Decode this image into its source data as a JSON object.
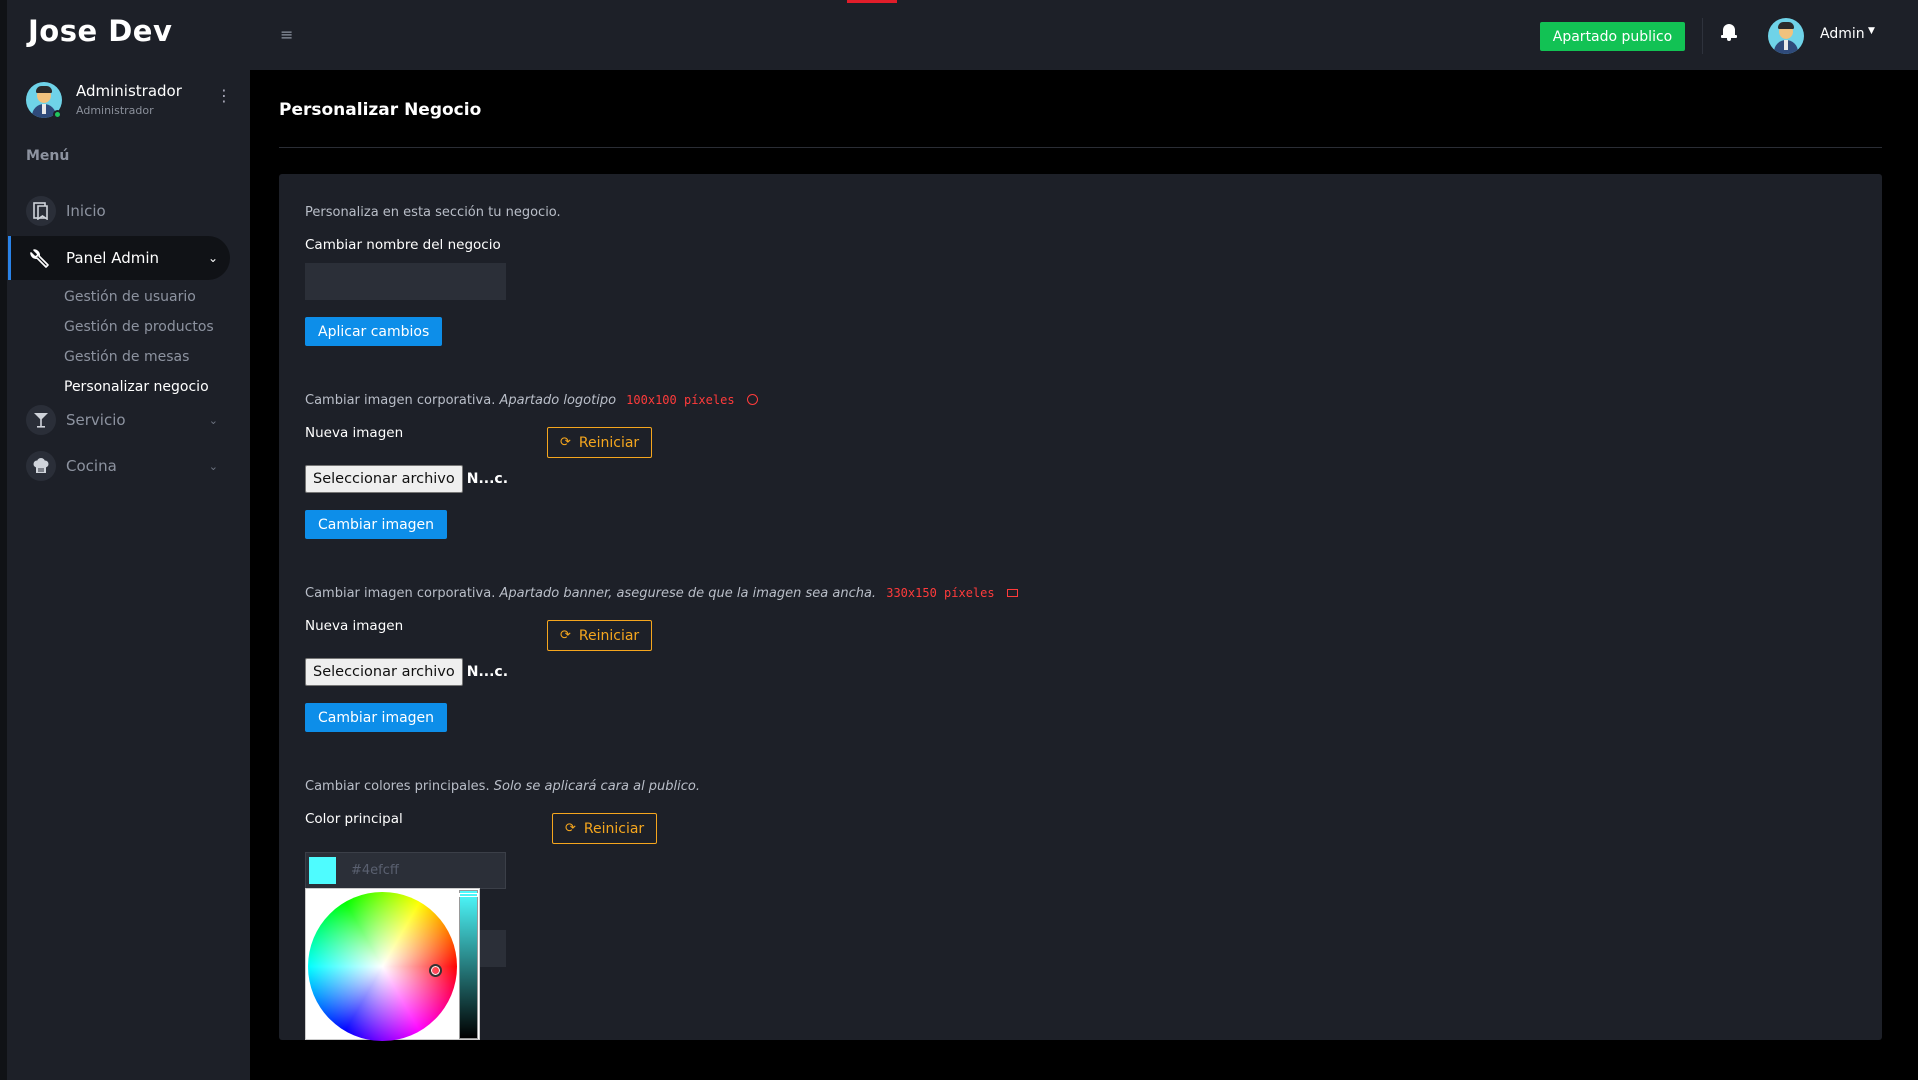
{
  "brand": "Jose Dev",
  "profile": {
    "name": "Administrador",
    "role": "Administrador"
  },
  "sidebar": {
    "menu_title": "Menú",
    "items": [
      {
        "label": "Inicio",
        "icon": "bookmark-icon"
      },
      {
        "label": "Panel Admin",
        "icon": "wrench-icon",
        "active": true
      },
      {
        "label": "Servicio",
        "icon": "cocktail-icon"
      },
      {
        "label": "Cocina",
        "icon": "chef-hat-icon"
      }
    ],
    "subitems": [
      "Gestión de usuario",
      "Gestión de productos",
      "Gestión de mesas",
      "Personalizar negocio"
    ]
  },
  "header": {
    "public_button": "Apartado publico",
    "user": "Admin"
  },
  "page": {
    "title": "Personalizar Negocio"
  },
  "section_name": {
    "intro": "Personaliza en esta sección tu negocio.",
    "label": "Cambiar nombre del negocio",
    "apply_button": "Aplicar cambios"
  },
  "section_logo": {
    "text": "Cambiar imagen corporativa.",
    "emph": "Apartado logotipo",
    "size": "100x100 píxeles",
    "label": "Nueva imagen",
    "reset_button": "Reiniciar",
    "file_button": "Seleccionar archivo",
    "file_name": "N...c.",
    "change_button": "Cambiar imagen"
  },
  "section_banner": {
    "text": "Cambiar imagen corporativa.",
    "emph": "Apartado banner, asegurese de que la imagen sea ancha.",
    "size": "330x150 píxeles",
    "label": "Nueva imagen",
    "reset_button": "Reiniciar",
    "file_button": "Seleccionar archivo",
    "file_name": "N...c.",
    "change_button": "Cambiar imagen"
  },
  "section_colors": {
    "text": "Cambiar colores principales.",
    "emph": "Solo se aplicará cara al publico.",
    "label": "Color principal",
    "reset_button": "Reiniciar",
    "color_value": "#4efcff",
    "swatch_color": "#4efcff"
  },
  "colors": {
    "sidebar_bg": "#1d2028",
    "accent_green": "#12c254",
    "accent_blue": "#0d8ee9",
    "accent_orange": "#f5a61e",
    "accent_red": "#ff3b3b"
  }
}
